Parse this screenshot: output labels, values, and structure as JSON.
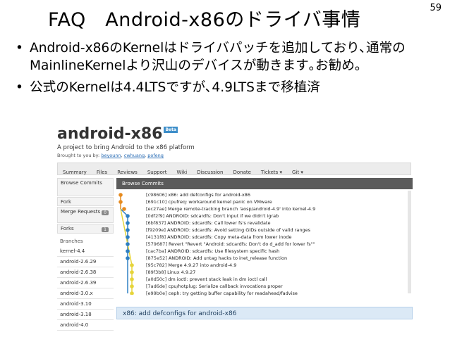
{
  "slide": {
    "title": "FAQ　Android-x86のドライバ事情",
    "page_number": "59",
    "bullet_char": "•",
    "bullets": [
      "Android-x86のKernelはドライバパッチを追加しており､通常のMainlineKernelより沢山のデバイスが動きます｡お勧め｡",
      "公式のKernelは4.4LTSですが､4.9LTSまで移植済"
    ]
  },
  "screenshot": {
    "logo": "android-x86",
    "beta": "Beta",
    "tagline": "A project to bring Android to the x86 platform",
    "brought_by_prefix": "Brought to you by:",
    "authors": [
      "beyounn",
      "cwhuang",
      "pofeng"
    ],
    "nav": [
      "Summary",
      "Files",
      "Reviews",
      "Support",
      "Wiki",
      "Discussion",
      "Donate",
      "Tickets ▾",
      "Git ▾"
    ],
    "sidebar": {
      "browse_commits": "Browse Commits",
      "fork": "Fork",
      "merge_requests": "Merge Requests",
      "merge_count": "0",
      "forks": "Forks",
      "forks_count": "1",
      "branches_header": "Branches",
      "branches": [
        "kernel-4.4",
        "android-2.6.29",
        "android-2.6.38",
        "android-2.6.39",
        "android-3.0.x",
        "android-3.10",
        "android-3.18",
        "android-4.0"
      ]
    },
    "panel_title": "Browse Commits",
    "commits": [
      {
        "id": "[c98606]",
        "msg": "x86: add defconfigs for android-x86"
      },
      {
        "id": "[691c10]",
        "msg": "cpufreq: workaround kernel panic on VMware"
      },
      {
        "id": "[ec27ae]",
        "msg": "Merge remote-tracking branch 'aosp/android-4.9' into kernel-4.9"
      },
      {
        "id": "[0df2f9]",
        "msg": "ANDROID: sdcardfs: Don't input if we didn't igrab"
      },
      {
        "id": "[6bf837]",
        "msg": "ANDROID: sdcardfs: Call lower fs's revalidate"
      },
      {
        "id": "[f9209e]",
        "msg": "ANDROID: sdcardfs: Avoid setting GIDs outside of valid ranges"
      },
      {
        "id": "[4131f8]",
        "msg": "ANDROID: sdcardfs: Copy meta-data from lower inode"
      },
      {
        "id": "[579687]",
        "msg": "Revert \"Revert \"Android: sdcardfs: Don't do d_add for lower fs\"\""
      },
      {
        "id": "[cac7ba]",
        "msg": "ANDROID: sdcardfs: Use filesystem specific hash"
      },
      {
        "id": "[875e52]",
        "msg": "ANDROID: Add untag hacks to inet_release function"
      },
      {
        "id": "[95c782]",
        "msg": "Merge 4.9.27 into android-4.9"
      },
      {
        "id": "[89f3b8]",
        "msg": "Linux 4.9.27"
      },
      {
        "id": "[a0d50c]",
        "msg": "dm ioctl: prevent stack leak in dm ioctl call"
      },
      {
        "id": "[7ad6de]",
        "msg": "cpu/hotplug: Serialize callback invocations proper"
      },
      {
        "id": "[e99b0e]",
        "msg": "ceph: try getting buffer capability for readahead/fadvise"
      }
    ],
    "detail_title": "x86: add defconfigs for android-x86",
    "colors": {
      "graph_orange": "#e68a1e",
      "graph_blue": "#2d7fc2",
      "graph_yellow": "#e6d43a",
      "panel_head": "#5b5b5b"
    }
  }
}
